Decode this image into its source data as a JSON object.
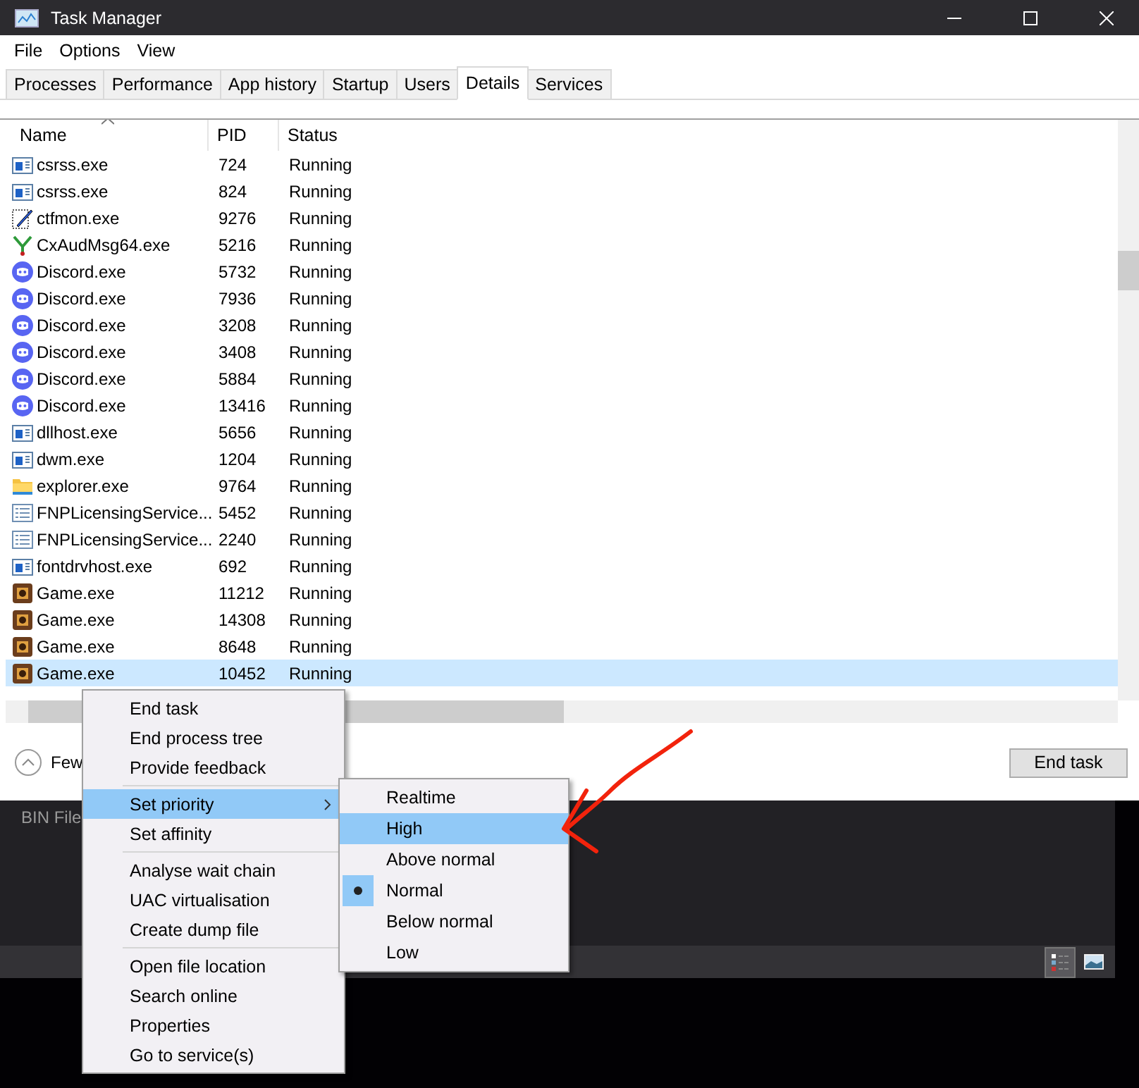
{
  "window": {
    "title": "Task Manager"
  },
  "menu_bar": [
    "File",
    "Options",
    "View"
  ],
  "tabs": [
    {
      "label": "Processes",
      "selected": false
    },
    {
      "label": "Performance",
      "selected": false
    },
    {
      "label": "App history",
      "selected": false
    },
    {
      "label": "Startup",
      "selected": false
    },
    {
      "label": "Users",
      "selected": false
    },
    {
      "label": "Details",
      "selected": true
    },
    {
      "label": "Services",
      "selected": false
    }
  ],
  "table": {
    "columns": [
      "Name",
      "PID",
      "Status"
    ],
    "rows": [
      {
        "kind": "window",
        "name": "csrss.exe",
        "pid": "724",
        "status": "Running",
        "selected": false
      },
      {
        "kind": "window",
        "name": "csrss.exe",
        "pid": "824",
        "status": "Running",
        "selected": false
      },
      {
        "kind": "pen",
        "name": "ctfmon.exe",
        "pid": "9276",
        "status": "Running",
        "selected": false
      },
      {
        "kind": "branch",
        "name": "CxAudMsg64.exe",
        "pid": "5216",
        "status": "Running",
        "selected": false
      },
      {
        "kind": "chat",
        "name": "Discord.exe",
        "pid": "5732",
        "status": "Running",
        "selected": false
      },
      {
        "kind": "chat",
        "name": "Discord.exe",
        "pid": "7936",
        "status": "Running",
        "selected": false
      },
      {
        "kind": "chat",
        "name": "Discord.exe",
        "pid": "3208",
        "status": "Running",
        "selected": false
      },
      {
        "kind": "chat",
        "name": "Discord.exe",
        "pid": "3408",
        "status": "Running",
        "selected": false
      },
      {
        "kind": "chat",
        "name": "Discord.exe",
        "pid": "5884",
        "status": "Running",
        "selected": false
      },
      {
        "kind": "chat",
        "name": "Discord.exe",
        "pid": "13416",
        "status": "Running",
        "selected": false
      },
      {
        "kind": "window",
        "name": "dllhost.exe",
        "pid": "5656",
        "status": "Running",
        "selected": false
      },
      {
        "kind": "window",
        "name": "dwm.exe",
        "pid": "1204",
        "status": "Running",
        "selected": false
      },
      {
        "kind": "folder",
        "name": "explorer.exe",
        "pid": "9764",
        "status": "Running",
        "selected": false
      },
      {
        "kind": "list",
        "name": "FNPLicensingService...",
        "pid": "5452",
        "status": "Running",
        "selected": false
      },
      {
        "kind": "list",
        "name": "FNPLicensingService...",
        "pid": "2240",
        "status": "Running",
        "selected": false
      },
      {
        "kind": "window",
        "name": "fontdrvhost.exe",
        "pid": "692",
        "status": "Running",
        "selected": false
      },
      {
        "kind": "game",
        "name": "Game.exe",
        "pid": "11212",
        "status": "Running",
        "selected": false
      },
      {
        "kind": "game",
        "name": "Game.exe",
        "pid": "14308",
        "status": "Running",
        "selected": false
      },
      {
        "kind": "game",
        "name": "Game.exe",
        "pid": "8648",
        "status": "Running",
        "selected": false
      },
      {
        "kind": "game",
        "name": "Game.exe",
        "pid": "10452",
        "status": "Running",
        "selected": true
      }
    ]
  },
  "footer": {
    "details_toggle": "Few",
    "end_task": "End task"
  },
  "background_window": {
    "label": "BIN File"
  },
  "context_menu": {
    "groups": [
      [
        {
          "label": "End task",
          "highlighted": false
        },
        {
          "label": "End process tree",
          "highlighted": false
        },
        {
          "label": "Provide feedback",
          "highlighted": false
        }
      ],
      [
        {
          "label": "Set priority",
          "highlighted": true,
          "submenu": true
        },
        {
          "label": "Set affinity",
          "highlighted": false
        }
      ],
      [
        {
          "label": "Analyse wait chain",
          "highlighted": false
        },
        {
          "label": "UAC virtualisation",
          "highlighted": false
        },
        {
          "label": "Create dump file",
          "highlighted": false
        }
      ],
      [
        {
          "label": "Open file location",
          "highlighted": false
        },
        {
          "label": "Search online",
          "highlighted": false
        },
        {
          "label": "Properties",
          "highlighted": false
        },
        {
          "label": "Go to service(s)",
          "highlighted": false
        }
      ]
    ]
  },
  "priority_submenu": [
    {
      "label": "Realtime",
      "selected": false,
      "highlighted": false
    },
    {
      "label": "High",
      "selected": false,
      "highlighted": true
    },
    {
      "label": "Above normal",
      "selected": false,
      "highlighted": false
    },
    {
      "label": "Normal",
      "selected": true,
      "highlighted": false
    },
    {
      "label": "Below normal",
      "selected": false,
      "highlighted": false
    },
    {
      "label": "Low",
      "selected": false,
      "highlighted": false
    }
  ]
}
